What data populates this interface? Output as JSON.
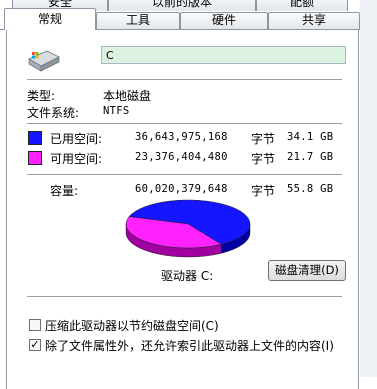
{
  "tabs_top": [
    "安全",
    "以前的版本",
    "配额"
  ],
  "tabs": [
    "常规",
    "工具",
    "硬件",
    "共享"
  ],
  "drive_name_value": "C",
  "type_label": "类型:",
  "type_value": "本地磁盘",
  "fs_label": "文件系统:",
  "fs_value": "NTFS",
  "used": {
    "label": "已用空间:",
    "bytes": "36,643,975,168",
    "unit": "字节",
    "size": "34.1 GB",
    "color": "#1515ff"
  },
  "free": {
    "label": "可用空间:",
    "bytes": "23,376,404,480",
    "unit": "字节",
    "size": "21.7 GB",
    "color": "#ff22ff"
  },
  "capacity": {
    "label": "容量:",
    "bytes": "60,020,379,648",
    "unit": "字节",
    "size": "55.8 GB"
  },
  "drive_label": "驱动器 C:",
  "cleanup_button": "磁盘清理(D)",
  "compress_label": "压缩此驱动器以节约磁盘空间(C)",
  "compress_checked": false,
  "index_label": "除了文件属性外，还允许索引此驱动器上文件的内容(I)",
  "index_checked": true,
  "pie_used_fraction": 0.61,
  "icons": {
    "drive": "hard-drive-icon",
    "check": "check-mark-icon"
  }
}
